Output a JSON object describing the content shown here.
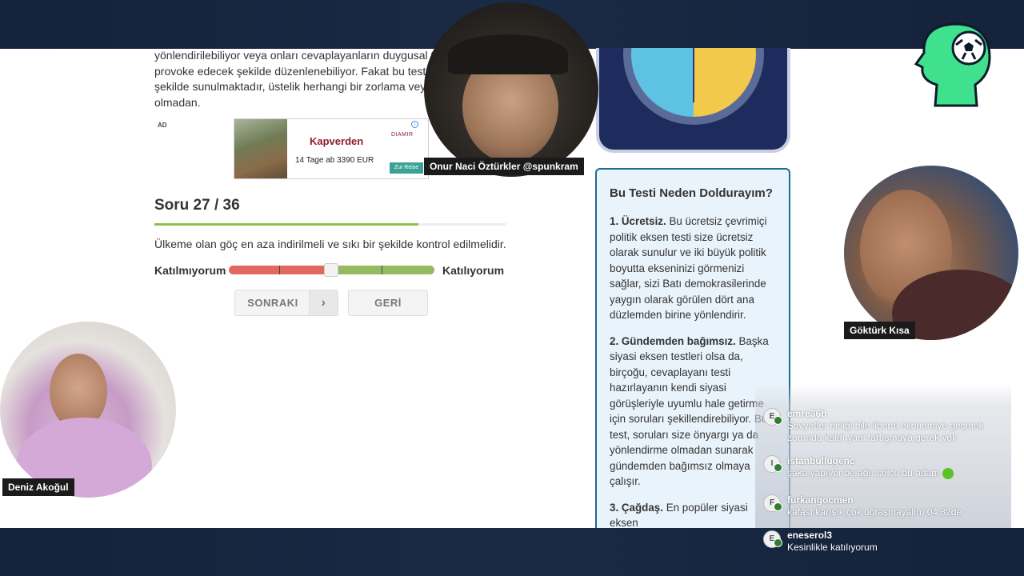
{
  "article": {
    "intro_lines": [
      "yönlendirilebiliyor veya onları cevaplayanların duygusal te",
      "provoke edecek şekilde düzenlenebiliyor. Fakat bu test s",
      "şekilde sunulmaktadır, üstelik herhangi bir zorlama veya",
      "olmadan."
    ]
  },
  "ad": {
    "label": "AD",
    "title": "Kapverden",
    "subtitle": "14 Tage ab 3390 EUR",
    "brand": "DIAMIR",
    "cta": "Zur Reise",
    "info": "i"
  },
  "quiz": {
    "question_counter": "Soru 27 / 36",
    "progress": 0.75,
    "question": "Ülkeme olan göç en aza indirilmeli ve sıkı bir şekilde kontrol edilmelidir.",
    "scale_left": "Katılmıyorum",
    "scale_right": "Katılıyorum",
    "next_label": "SONRAKI",
    "next_arrow": "›",
    "back_label": "GERİ"
  },
  "sidebar": {
    "title": "Bu Testi Neden Doldurayım?",
    "items": [
      {
        "heading": "1. Ücretsiz.",
        "text": " Bu ücretsiz çevrimiçi politik eksen testi size ücretsiz olarak sunulur ve iki büyük politik boyutta ekseninizi görmenizi sağlar, sizi Batı demokrasilerinde yaygın olarak görülen dört ana düzlemden birine yönlendirir."
      },
      {
        "heading": "2. Gündemden bağımsız.",
        "text": " Başka siyasi eksen testleri olsa da, birçoğu, cevaplayanı testi hazırlayanın kendi siyasi görüşleriyle uyumlu hale getirme için soruları şekillendirebiliyor. Bu test, soruları size önyargı ya da yönlendirme olmadan sunarak gündemden bağımsız olmaya çalışır."
      },
      {
        "heading": "3. Çağdaş.",
        "text": " En popüler siyasi eksen"
      }
    ]
  },
  "streamers": {
    "center": "Onur Naci Öztürkler @spunkram",
    "left": "Deniz Akoğul",
    "right": "Göktürk Kısa"
  },
  "chat": {
    "messages": [
      {
        "initial": "E",
        "user": "emre36b",
        "text": "Sovyetler birliği bile liberal ekonomiye geçmek zorunda kaldı yani tartışmaya gerek yok"
      },
      {
        "initial": "I",
        "user": "istanbullugenc",
        "text": "şaka yapıyor be ağır solcu bu adam"
      },
      {
        "initial": "F",
        "user": "furkangocmen",
        "text": "kafası karışık çok uğraşmayalım 04.32de"
      },
      {
        "initial": "E",
        "user": "eneserol3",
        "text": "Kesinlikle katılıyorum"
      }
    ]
  },
  "colors": {
    "accent_green": "#8bc34a",
    "scale_red": "#e0685d",
    "scale_green": "#96ba60",
    "info_border": "#1c6b92",
    "brand_green": "#3fe08e"
  }
}
